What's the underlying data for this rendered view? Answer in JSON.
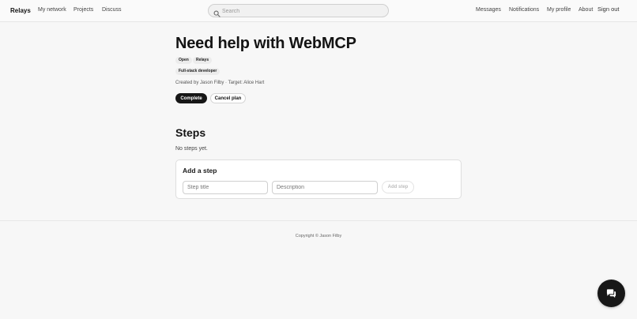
{
  "nav": {
    "brand": "Relays",
    "left_links": [
      "My network",
      "Projects",
      "Discuss"
    ],
    "search_placeholder": "Search",
    "right_links": [
      "Messages",
      "Notifications",
      "My profile",
      "About"
    ],
    "sign_out": "Sign out"
  },
  "plan": {
    "title": "Need help with WebMCP",
    "tags": [
      "Open",
      "Relays",
      "Full-stack developer"
    ],
    "meta": "Created by Jason Filby · Target: Alice Hart",
    "complete_label": "Complete",
    "cancel_label": "Cancel plan"
  },
  "steps": {
    "heading": "Steps",
    "empty_text": "No steps yet.",
    "add": {
      "heading": "Add a step",
      "title_placeholder": "Step title",
      "description_placeholder": "Description",
      "button_label": "Add step"
    }
  },
  "footer": {
    "copyright": "Copyright © Jason Filby"
  },
  "icons": {
    "search": "search-icon",
    "chat": "chat-icon"
  },
  "colors": {
    "primary_button": "#161616",
    "background": "#f7f7f7"
  }
}
